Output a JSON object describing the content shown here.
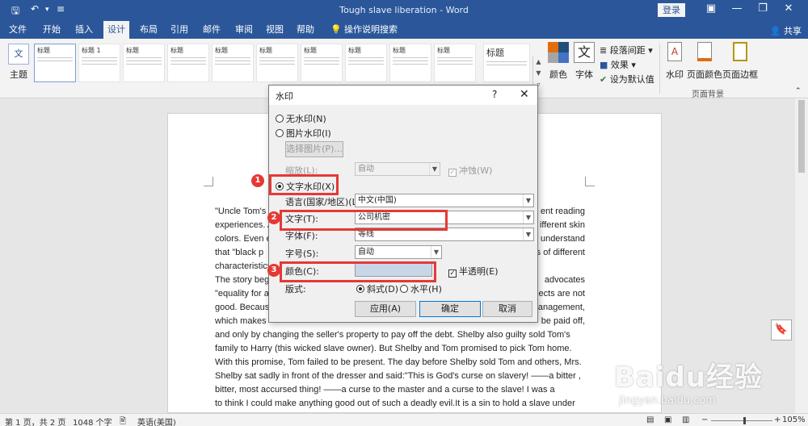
{
  "titlebar": {
    "doc_title": "Tough slave liberation - Word",
    "login": "登录"
  },
  "tabs": [
    "文件",
    "开始",
    "插入",
    "设计",
    "布局",
    "引用",
    "邮件",
    "审阅",
    "视图",
    "帮助",
    "操作说明搜索"
  ],
  "active_tab": "设计",
  "share": "共享",
  "ribbon": {
    "theme": "主题",
    "style_thumbs": [
      "标题",
      "标题 1",
      "标题",
      "标题",
      "标题",
      "标题",
      "标题",
      "标题",
      "标题",
      "标题",
      "标题"
    ],
    "colors": "颜色",
    "fonts": "字体",
    "paragraph_spacing": "段落间距",
    "effects": "效果",
    "set_default": "设为默认值",
    "watermark": "水印",
    "page_color": "页面颜色",
    "page_borders": "页面边框",
    "group_page_background": "页面背景"
  },
  "document": {
    "lines": [
      "\"Uncle Tom's",
      "experiences. A",
      "colors. Even e",
      "that \"black p",
      "characteristics",
      "The story beg",
      "\"equality for a",
      "good. Because",
      "which makes",
      "and only by changing the seller's property to pay off the debt. Shelby also guilty sold Tom's",
      "family to Harry (this wicked slave owner). But Shelby and Tom promised to pick Tom home.",
      "With this promise, Tom failed to be present. The day before Shelby sold Tom and others, Mrs.",
      "Shelby sat sadly in front of the dresser and said:\"This is God's curse on slavery! ——a bitter ,",
      "bitter, most accursed thing! ——a curse to the master and a curse to the slave! I was a",
      "to think I could make anything good out of such a deadly evil.It is a sin to hold a slave under"
    ],
    "right_fragments": [
      "ent reading",
      "ifferent skin",
      "understand",
      "s of different",
      "",
      "advocates",
      "ects are not",
      "anagement,",
      "be paid off,"
    ]
  },
  "dialog": {
    "title": "水印",
    "help": "?",
    "close": "✕",
    "no_watermark": "无水印(N)",
    "picture_watermark": "图片水印(I)",
    "select_picture": "选择图片(P)...",
    "scale_label": "缩放(L):",
    "scale_value": "自动",
    "washout": "冲蚀(W)",
    "text_watermark": "文字水印(X)",
    "language_label": "语言(国家/地区)(L):",
    "language_value": "中文(中国)",
    "text_label": "文字(T):",
    "text_value": "公司机密",
    "font_label": "字体(F):",
    "font_value": "等线",
    "size_label": "字号(S):",
    "size_value": "自动",
    "color_label": "颜色(C):",
    "semitransparent": "半透明(E)",
    "layout_label": "版式:",
    "diagonal": "斜式(D)",
    "horizontal": "水平(H)",
    "apply": "应用(A)",
    "ok": "确定",
    "cancel": "取消"
  },
  "annotations": [
    "1",
    "2",
    "3"
  ],
  "statusbar": {
    "page": "第 1 页，共 2 页",
    "words": "1048 个字",
    "language": "英语(美国)",
    "zoom": "105%"
  },
  "watermark_logo": {
    "text_big": "Baidu经验",
    "text_small": "jingyan.baidu.com"
  }
}
